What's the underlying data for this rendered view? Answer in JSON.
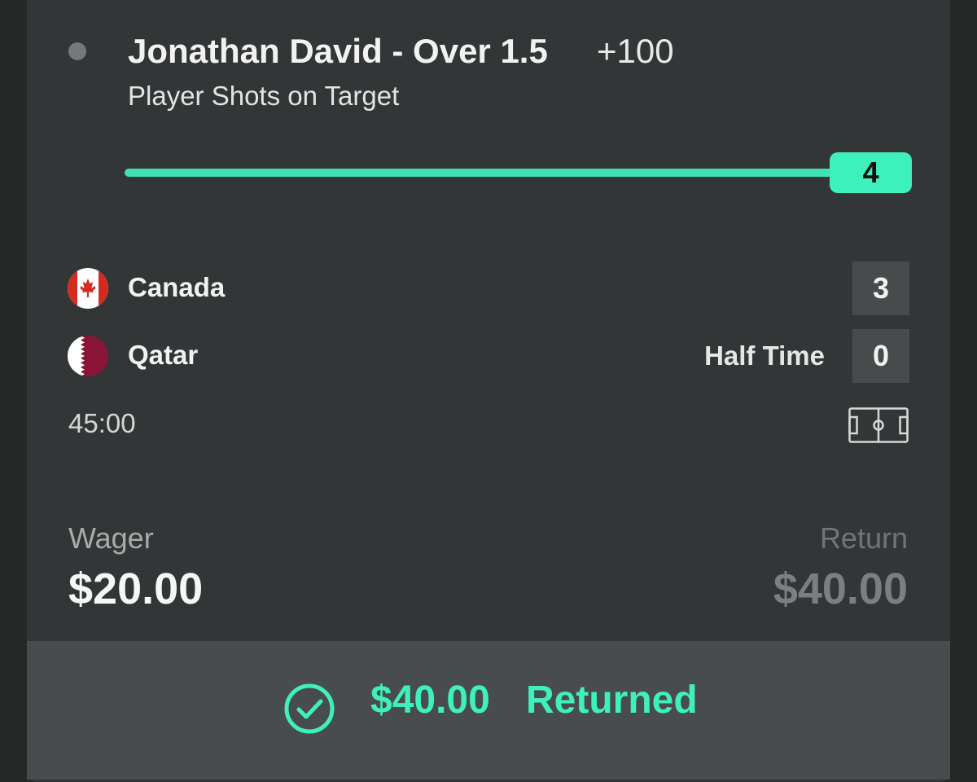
{
  "bet": {
    "selection": "Jonathan David - Over 1.5",
    "odds": "+100",
    "market": "Player Shots on Target",
    "progress": {
      "current": "4",
      "fraction": 1.0
    }
  },
  "match": {
    "home": {
      "name": "Canada",
      "score": "3",
      "flag_icon": "canada-flag"
    },
    "away": {
      "name": "Qatar",
      "score": "0",
      "flag_icon": "qatar-flag"
    },
    "period": "Half Time",
    "clock": "45:00",
    "pitch_icon": "soccer-pitch-icon"
  },
  "wager": {
    "label": "Wager",
    "amount": "$20.00"
  },
  "return": {
    "label": "Return",
    "amount": "$40.00"
  },
  "status": {
    "icon": "check-circle-icon",
    "amount": "$40.00",
    "label": "Returned"
  },
  "colors": {
    "accent": "#3ef0bb",
    "card": "#333637",
    "footer": "#494c4d"
  }
}
